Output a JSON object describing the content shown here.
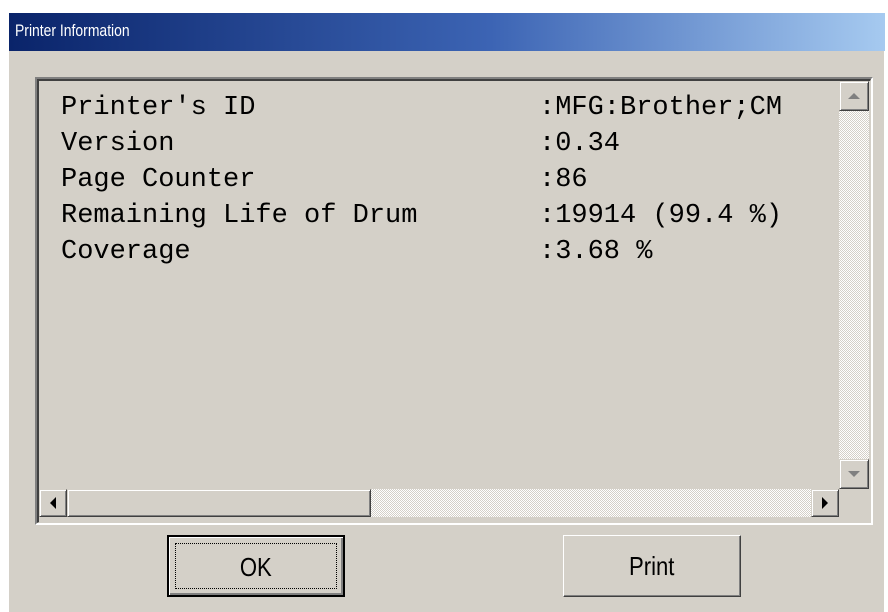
{
  "window": {
    "title": "Printer Information"
  },
  "info": {
    "rows": [
      {
        "label": "Printer's ID",
        "value": ":MFG:Brother;CM"
      },
      {
        "label": "Version",
        "value": ":0.34"
      },
      {
        "label": "Page Counter",
        "value": ":86"
      },
      {
        "label": "Remaining Life of Drum",
        "value": ":19914 (99.4 %)"
      },
      {
        "label": "Coverage",
        "value": ":3.68 %"
      }
    ]
  },
  "scrollbars": {
    "up_icon": "arrow-up-icon",
    "down_icon": "arrow-down-icon",
    "left_icon": "arrow-left-icon",
    "right_icon": "arrow-right-icon"
  },
  "buttons": {
    "ok_label": "OK",
    "print_label": "Print"
  },
  "colors": {
    "titlebar_start": "#0a246a",
    "titlebar_end": "#a6caf0",
    "face": "#d4d0c8"
  }
}
